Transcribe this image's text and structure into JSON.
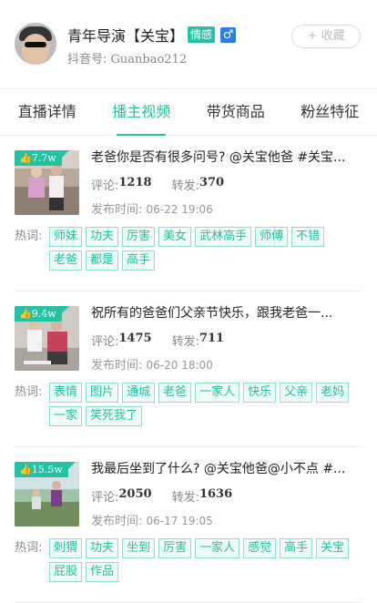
{
  "profile": {
    "name": "青年导演【关宝】",
    "tag": "情感",
    "gender_symbol": "♂",
    "douyin_label": "抖音号:",
    "douyin_id": "Guanbao212",
    "collect": "+ 收藏"
  },
  "tabs": [
    "直播详情",
    "播主视频",
    "带货商品",
    "粉丝特征"
  ],
  "labels": {
    "comments": "评论:",
    "shares": "转发:",
    "publish": "发布时间:",
    "hotwords": "热词:"
  },
  "videos": [
    {
      "likes": "7.7w",
      "title": "老爸你是否有很多问号? @关宝他爸 #关宝...",
      "comments": "1218",
      "shares": "370",
      "time": "06-22 19:06",
      "hotwords": [
        "师妹",
        "功夫",
        "厉害",
        "美女",
        "武林高手",
        "师傅",
        "不错",
        "老爸",
        "都是",
        "高手"
      ]
    },
    {
      "likes": "9.4w",
      "title": "祝所有的爸爸们父亲节快乐，跟我老爸一...",
      "comments": "1475",
      "shares": "711",
      "time": "06-20 18:00",
      "hotwords": [
        "表情",
        "图片",
        "通城",
        "老爸",
        "一家人",
        "快乐",
        "父亲",
        "老妈",
        "一家",
        "笑死我了"
      ]
    },
    {
      "likes": "15.5w",
      "title": "我最后坐到了什么? @关宝他爸@小不点 #...",
      "comments": "2050",
      "shares": "1636",
      "time": "06-17 19:05",
      "hotwords": [
        "刺猬",
        "功夫",
        "坐到",
        "厉害",
        "一家人",
        "感觉",
        "高手",
        "关宝",
        "屁股",
        "作品"
      ]
    }
  ],
  "colors": {
    "accent": "#24c2a2",
    "gender": "#2f7de1"
  }
}
